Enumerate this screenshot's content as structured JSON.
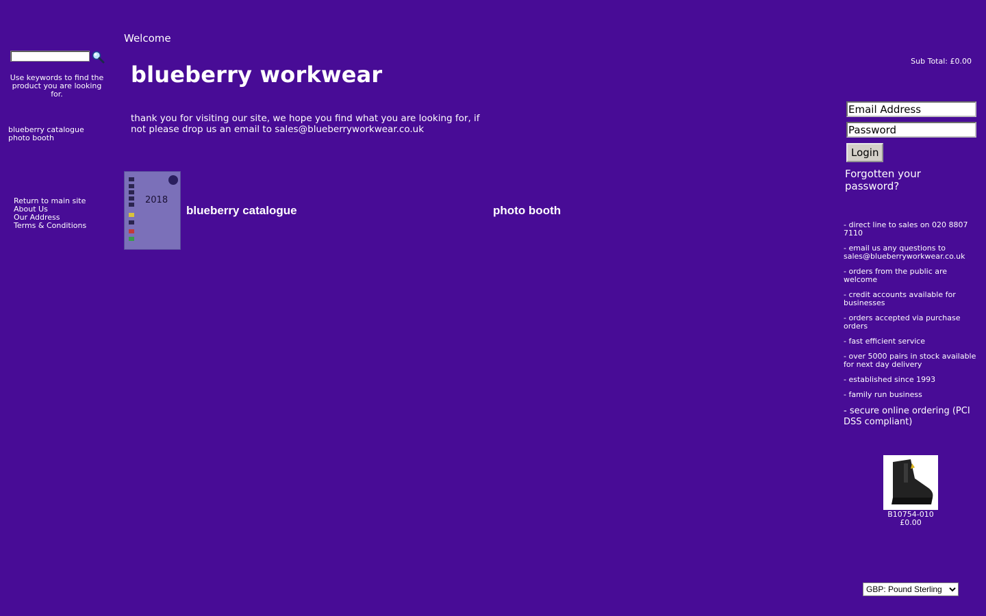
{
  "search": {
    "value": "",
    "placeholder": "",
    "hint": "Use keywords to find the product you are looking for."
  },
  "categories": [
    "blueberry catalogue",
    "photo booth"
  ],
  "info_links": [
    "Return to main site",
    "About Us",
    "Our Address",
    "Terms & Conditions"
  ],
  "main": {
    "welcome": "Welcome",
    "title": "blueberry workwear",
    "intro": "thank you for visiting our site, we hope you find what you are looking for, if not please drop us an email to sales@blueberryworkwear.co.uk",
    "catalogue_thumb_year": "2018",
    "category_links": [
      "blueberry catalogue",
      "photo booth"
    ]
  },
  "cart": {
    "subtotal": "Sub Total: £0.00"
  },
  "login": {
    "email_placeholder": "Email Address",
    "password_placeholder": "Password",
    "button": "Login",
    "forgot": "Forgotten your password?"
  },
  "features": [
    "- direct line to sales on 020 8807 7110",
    "- email us any questions to sales@blueberryworkwear.co.uk",
    "- orders from the public are welcome",
    "- credit accounts available for businesses",
    "- orders accepted via purchase orders",
    "- fast efficient service",
    "- over 5000 pairs in stock available for next day delivery",
    "- established since 1993",
    "- family run business",
    "- secure online ordering (PCI DSS compliant)"
  ],
  "product": {
    "code": "B10754-010",
    "price": "£0.00"
  },
  "currency": {
    "selected": "GBP: Pound Sterling"
  },
  "colors": {
    "background": "#480c96",
    "text": "#ffffff"
  }
}
